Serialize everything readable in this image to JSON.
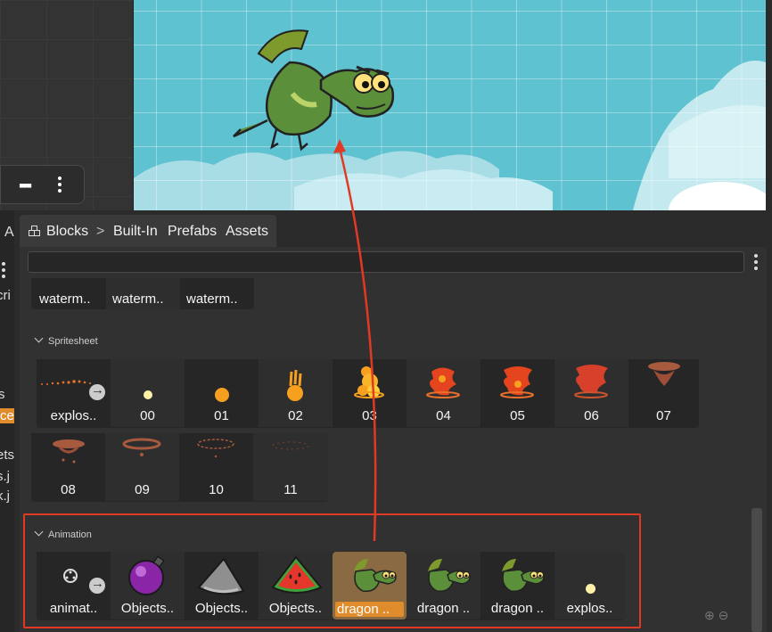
{
  "tabs": {
    "blocks_label": "Blocks",
    "separator": ">",
    "built_in": "Built-In",
    "prefabs": "Prefabs",
    "assets": "Assets"
  },
  "left_panel": {
    "tab_letter": "A",
    "fragments": [
      "cri",
      "s",
      "ce",
      "ets",
      "s.j",
      "k.j"
    ]
  },
  "search": {
    "value": ""
  },
  "top_row": {
    "labels": [
      "waterm..",
      "waterm..",
      "waterm.."
    ]
  },
  "spritesheet": {
    "title": "Spritesheet",
    "row1": [
      "explos..",
      "00",
      "01",
      "02",
      "03",
      "04",
      "05",
      "06",
      "07"
    ],
    "row2": [
      "08",
      "09",
      "10",
      "11"
    ]
  },
  "animation": {
    "title": "Animation",
    "items": [
      "animat..",
      "Objects..",
      "Objects..",
      "Objects..",
      "dragon ..",
      "dragon ..",
      "dragon ..",
      "explos.."
    ]
  },
  "colors": {
    "accent_selected": "#e08b2c",
    "annotation_red": "#e03a24",
    "scene_sky": "#5fc2d0"
  },
  "icons": {
    "blocks": "blocks-grid-icon",
    "chevron": "chevron-right-icon",
    "more": "more-vertical-icon",
    "zoom_in": "zoom-in-icon",
    "zoom_out": "zoom-out-icon"
  }
}
